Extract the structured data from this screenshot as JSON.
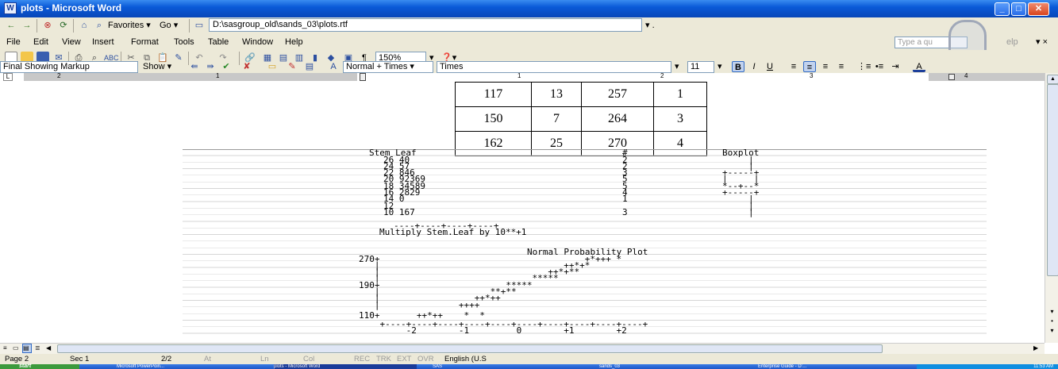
{
  "window": {
    "title": "plots - Microsoft Word",
    "app_icon": "W",
    "minimize": "_",
    "maximize": "□",
    "close": "✕"
  },
  "web_toolbar": {
    "favorites": "Favorites ▾",
    "go": "Go ▾",
    "address": "D:\\sasgroup_old\\sands_03\\plots.rtf",
    "dropdown": "▾ ."
  },
  "menu": {
    "items": [
      "File",
      "Edit",
      "View",
      "Insert",
      "Format",
      "Tools",
      "Table",
      "Window",
      "Help"
    ],
    "help_placeholder": "Type a qu",
    "help_suffix": "elp",
    "close_doc": "▾ ×"
  },
  "standard_toolbar": {
    "zoom": "150%",
    "zoom_arrow": "▾",
    "help_btn": "❓▾"
  },
  "formatting_toolbar": {
    "markup": "Final Showing Markup",
    "show": "Show ▾",
    "style": "Normal + Times ▾",
    "font": "Times",
    "font_arrow": "▾",
    "size": "11",
    "size_arrow": "▾",
    "bold": "B",
    "italic": "I",
    "underline": "U"
  },
  "ruler": {
    "numbers": [
      "2",
      "1",
      "1",
      "2",
      "3",
      "4"
    ]
  },
  "data_table": {
    "rows": [
      [
        "117",
        "13",
        "257",
        "1"
      ],
      [
        "150",
        "7",
        "264",
        "3"
      ],
      [
        "162",
        "25",
        "270",
        "4"
      ]
    ]
  },
  "sas_output": {
    "header_stem": "Stem Leaf",
    "header_count": "#",
    "header_boxplot": "Boxplot",
    "stem_rows": [
      {
        "stem": "26 40",
        "count": "2",
        "box": "|"
      },
      {
        "stem": "24 57",
        "count": "2",
        "box": "|"
      },
      {
        "stem": "22 846",
        "count": "3",
        "box": "+-----+"
      },
      {
        "stem": "20 92369",
        "count": "5",
        "box": "|     |"
      },
      {
        "stem": "18 34589",
        "count": "5",
        "box": "*--+--*"
      },
      {
        "stem": "16 2829",
        "count": "4",
        "box": "+-----+"
      },
      {
        "stem": "14 0",
        "count": "1",
        "box": "|"
      },
      {
        "stem": "12",
        "count": "",
        "box": "|"
      },
      {
        "stem": "10 167",
        "count": "3",
        "box": "|"
      }
    ],
    "stem_axis": "----+----+----+----+",
    "multiply_note": "Multiply Stem.Leaf by 10**+1",
    "npp_title": "Normal Probability Plot",
    "npp_lines": [
      "270+                                       +*+++ *",
      "   |                                   ++*+*",
      "   |                                ++*+**",
      "   |                             *****",
      "190+                        *****",
      "   |                     **+**",
      "   |                  ++*++",
      "   |               ++++",
      "110+       ++*++    *  *",
      "    +----+----+----+----+----+----+----+----+----+----+",
      "         -2        -1         0        +1        +2"
    ]
  },
  "status": {
    "page": "Page 2",
    "sec": "Sec 1",
    "pages": "2/2",
    "at": "At",
    "ln": "Ln",
    "col": "Col",
    "rec": "REC",
    "trk": "TRK",
    "ext": "EXT",
    "ovr": "OVR",
    "lang": "English (U.S"
  },
  "taskbar": {
    "start": "start",
    "items": [
      "Microsoft PowerPoin...",
      "plots - Microsoft Word",
      "SAS",
      "sands_03",
      "Enterprise Guide - D:..."
    ],
    "clock": "11:53 AM"
  },
  "colors": {
    "titlebar": "#0a5ad8",
    "toolbar_bg": "#ece9d8",
    "taskbar": "#1d56c8"
  }
}
